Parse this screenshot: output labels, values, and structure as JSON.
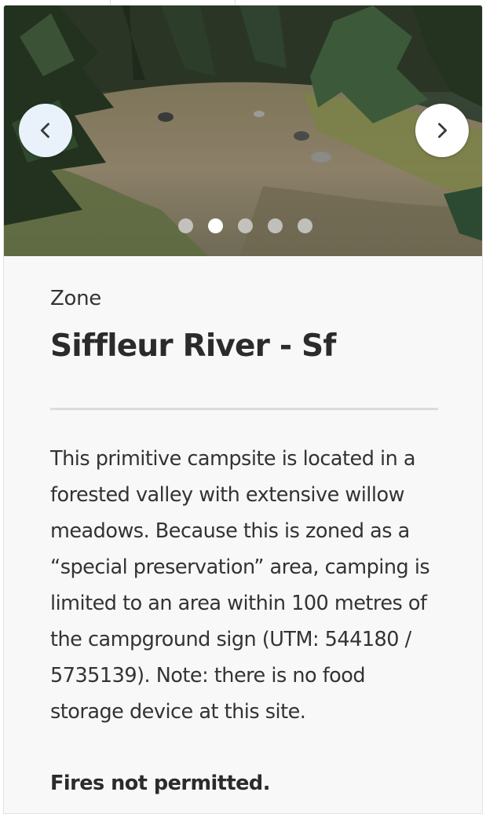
{
  "carousel": {
    "prev_icon": "chevron-left-icon",
    "next_icon": "chevron-right-icon",
    "slide_count": 5,
    "active_slide": 2,
    "photo_description_icon": "forest-campsite-photo"
  },
  "zone": {
    "label": "Zone",
    "title": "Siffleur River - Sf"
  },
  "description": "This primitive campsite is located in a forested valley with extensive willow meadows. Because this is zoned as a “special preservation” area, camping is limited to an area within 100 metres of the campground sign (UTM: 544180 / 5735139). Note: there is no food storage device at this site.",
  "fire_note": "Fires not permitted.",
  "colors": {
    "card_background": "#f8f8f8",
    "prev_button_background": "#e9f1fb",
    "next_button_background": "#ffffff",
    "divider": "#dcdcdc",
    "text": "#333333"
  }
}
